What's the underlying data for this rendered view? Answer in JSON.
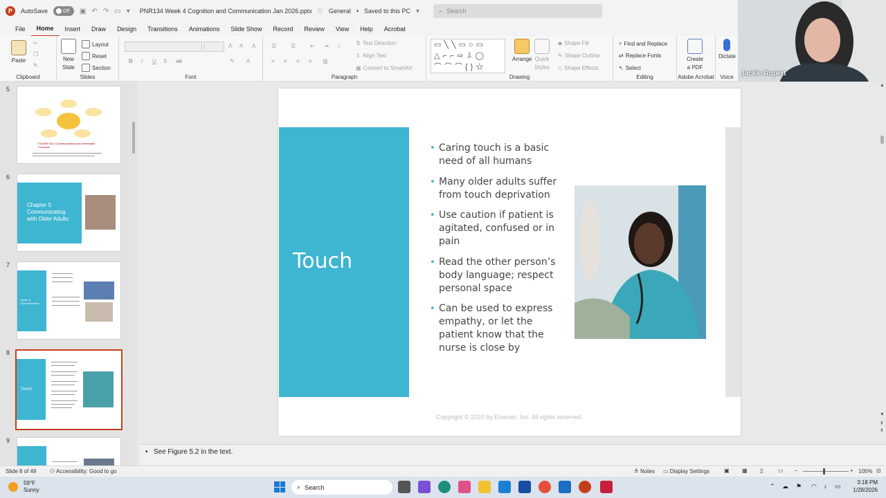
{
  "app": {
    "autosave_label": "AutoSave",
    "autosave_state": "Off",
    "file_name": "PNR134 Week 4 Cognition and Communication Jan 2026.pptx",
    "sensitivity": "General",
    "save_status": "Saved to this PC",
    "search_placeholder": "Search"
  },
  "menu": [
    "File",
    "Home",
    "Insert",
    "Draw",
    "Design",
    "Transitions",
    "Animations",
    "Slide Show",
    "Record",
    "Review",
    "View",
    "Help",
    "Acrobat"
  ],
  "ribbon": {
    "clipboard": {
      "paste": "Paste",
      "label": "Clipboard"
    },
    "slides": {
      "new_slide": "New",
      "new_slide2": "Slide",
      "layout": "Layout",
      "reset": "Reset",
      "section": "Section",
      "label": "Slides"
    },
    "font": {
      "label": "Font",
      "bold": "B",
      "italic": "I",
      "underline": "U",
      "shadow": "S",
      "strike": "ab"
    },
    "paragraph": {
      "label": "Paragraph",
      "text_direction": "Text Direction",
      "align_text": "Align Text",
      "smartart": "Convert to SmartArt"
    },
    "drawing": {
      "label": "Drawing",
      "arrange": "Arrange",
      "quick_styles": "Quick",
      "quick_styles2": "Styles",
      "shape_fill": "Shape Fill",
      "shape_outline": "Shape Outline",
      "shape_effects": "Shape Effects"
    },
    "editing": {
      "label": "Editing",
      "find_replace": "Find and Replace",
      "replace_fonts": "Replace Fonts",
      "select": "Select"
    },
    "acrobat": {
      "label": "Adobe Acrobat",
      "create": "Create",
      "create2": "a PDF"
    },
    "voice": {
      "label": "Voice",
      "dictate": "Dictate"
    }
  },
  "webcam": {
    "name": "Jackie Rupert"
  },
  "thumbnails": [
    {
      "num": "5",
      "caption": "FIGURE 55-4 Communication and Interrelated Concepts"
    },
    {
      "num": "6",
      "title": "Chapter 5 Communicating with Older Adults"
    },
    {
      "num": "7",
      "title": "Types of Communication"
    },
    {
      "num": "8",
      "title": "Touch"
    },
    {
      "num": "9",
      "title": ""
    }
  ],
  "slide": {
    "title": "Touch",
    "bullets": [
      "Caring touch is a basic need of all humans",
      "Many older adults suffer from touch deprivation",
      "Use caution if patient is agitated, confused or in pain",
      "Read the other person’s body language; respect personal space",
      "Can be used to express empathy, or let the patient know that the nurse is close by"
    ],
    "copyright": "Copyright © 2020 by Elsevier, Inc. All rights reserved."
  },
  "notes": {
    "text": "See Figure 5.2 in the text."
  },
  "status": {
    "slide_count": "Slide 8 of 49",
    "accessibility": "Accessibility: Good to go",
    "notes": "Notes",
    "display_settings": "Display Settings",
    "zoom": "105%"
  },
  "taskbar": {
    "temp": "59°F",
    "weather": "Sunny",
    "search": "Search",
    "time": "3:18 PM",
    "date": "1/28/2026"
  },
  "colors": {
    "accent": "#3eb5d1",
    "office_red": "#c43e1c"
  }
}
